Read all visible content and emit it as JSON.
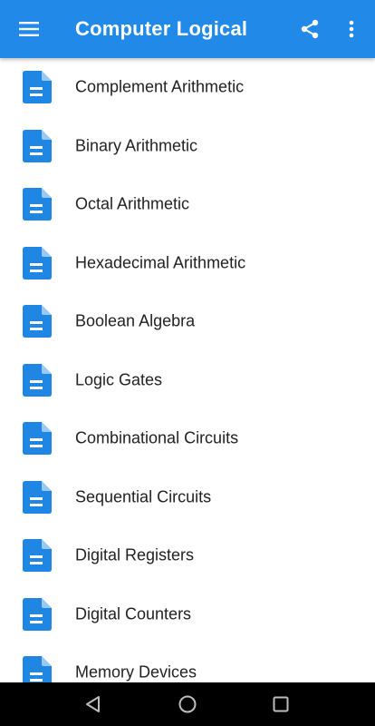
{
  "toolbar": {
    "title": "Computer Logical",
    "background_color": "#2189e8",
    "icons": [
      "menu-icon",
      "share-icon",
      "more-vert-icon"
    ]
  },
  "list": {
    "icon": "document-icon",
    "icon_color": "#1f86e4",
    "items": [
      {
        "label": "Complement Arithmetic"
      },
      {
        "label": "Binary Arithmetic"
      },
      {
        "label": "Octal Arithmetic"
      },
      {
        "label": "Hexadecimal Arithmetic"
      },
      {
        "label": "Boolean Algebra"
      },
      {
        "label": "Logic Gates"
      },
      {
        "label": "Combinational Circuits"
      },
      {
        "label": "Sequential Circuits"
      },
      {
        "label": "Digital Registers"
      },
      {
        "label": "Digital Counters"
      },
      {
        "label": "Memory Devices"
      }
    ]
  },
  "navbar": {
    "icons": [
      "back-triangle-icon",
      "home-circle-icon",
      "recents-square-icon"
    ]
  }
}
